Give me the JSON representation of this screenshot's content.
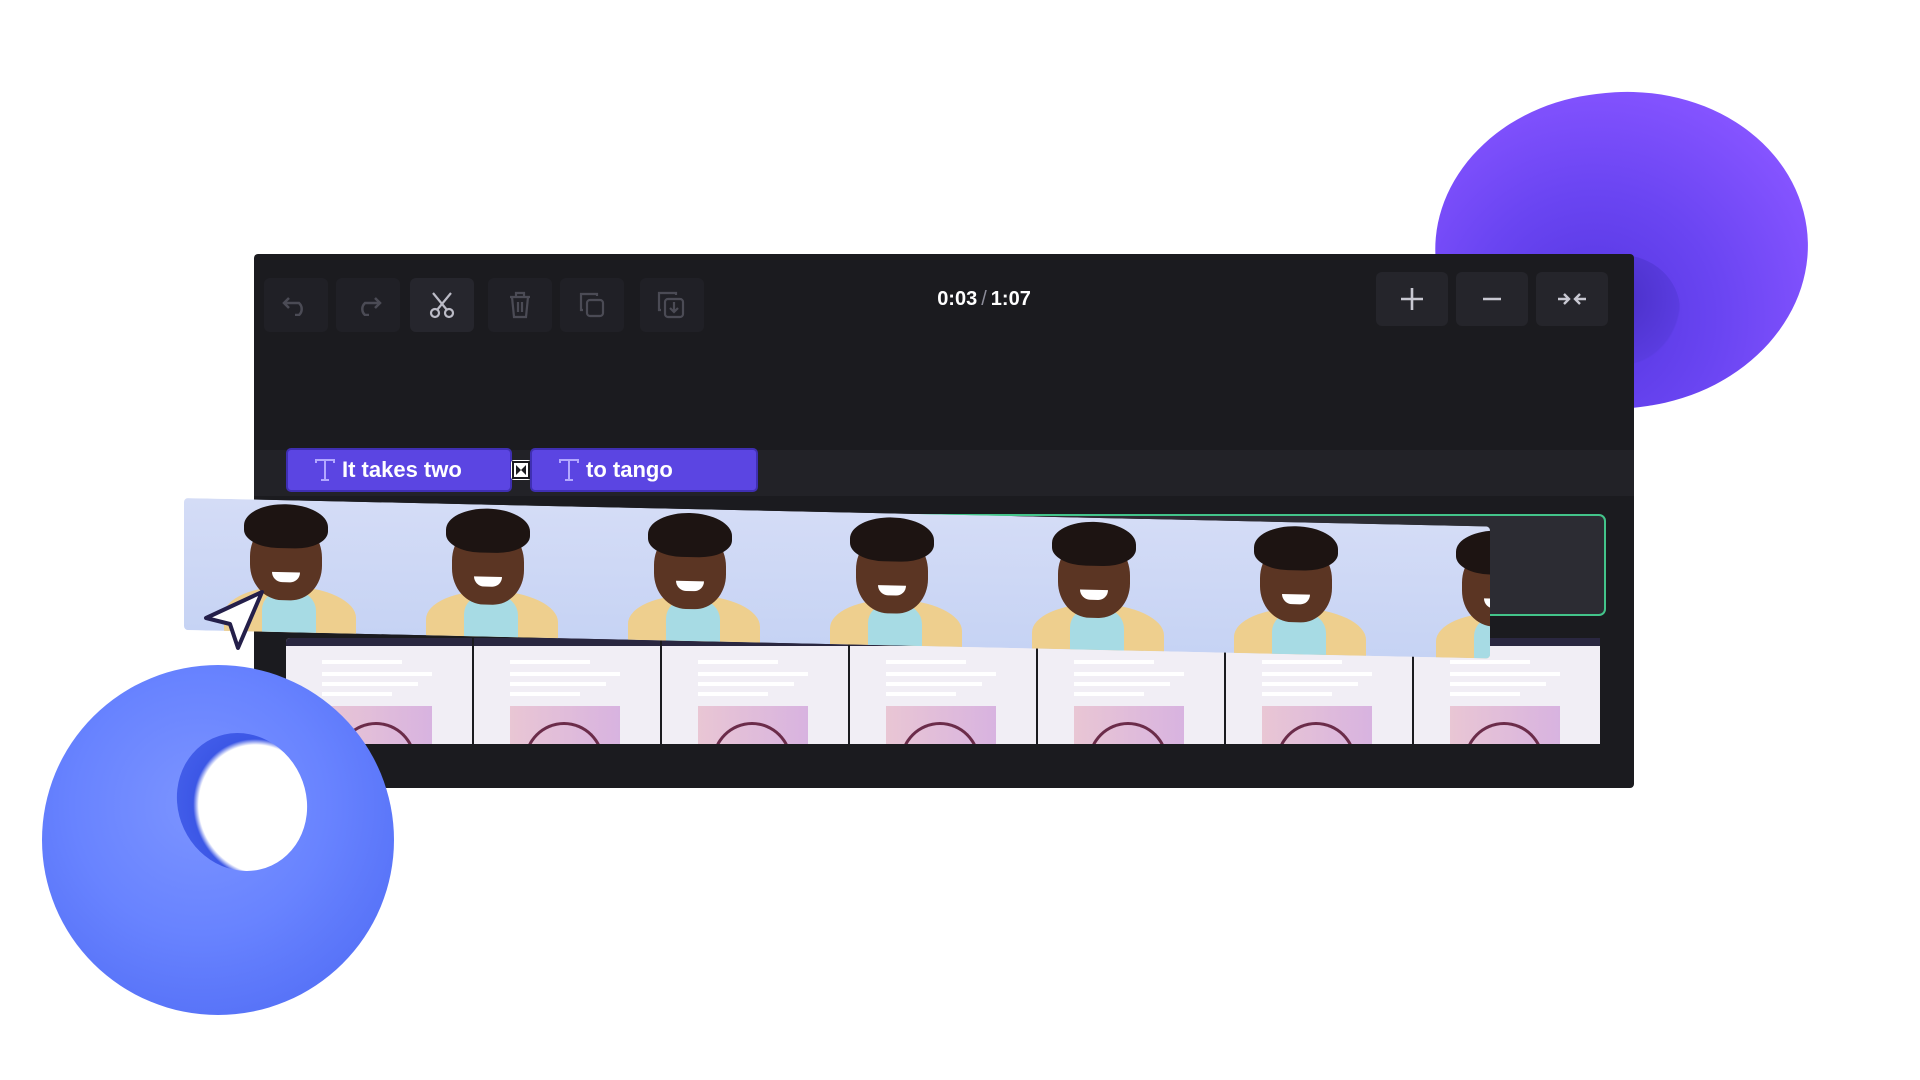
{
  "toolbar": {
    "buttons": [
      "undo-icon",
      "redo-icon",
      "split-icon",
      "delete-icon",
      "duplicate-icon",
      "download-icon"
    ],
    "time_current": "0:03",
    "time_separator": "/",
    "time_total": "1:07",
    "zoom": [
      "zoom-in-icon",
      "zoom-out-icon",
      "fit-icon"
    ]
  },
  "timeline": {
    "text_clips": [
      {
        "label": "It takes two"
      },
      {
        "label": "to tango"
      }
    ]
  },
  "colors": {
    "panel": "#1b1b1f",
    "accent": "#5b45e2",
    "selection": "#43c48a"
  }
}
